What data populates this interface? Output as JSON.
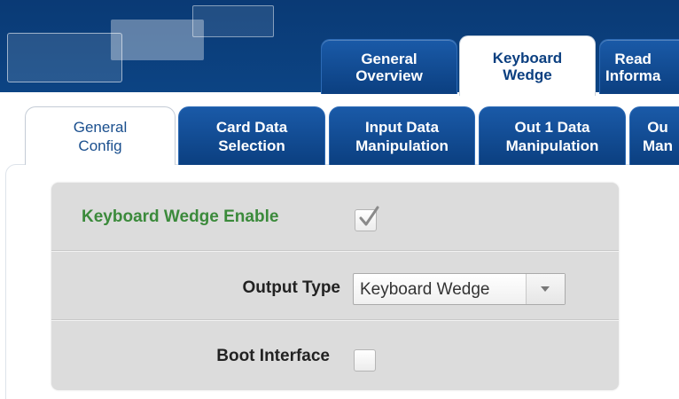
{
  "top_tabs": [
    {
      "label": "General\nOverview",
      "active": false
    },
    {
      "label": "Keyboard\nWedge",
      "active": true
    },
    {
      "label": "Read\nInforma",
      "active": false
    }
  ],
  "sub_tabs": [
    {
      "label": "General\nConfig",
      "active": true
    },
    {
      "label": "Card Data\nSelection",
      "active": false
    },
    {
      "label": "Input Data\nManipulation",
      "active": false
    },
    {
      "label": "Out 1 Data\nManipulation",
      "active": false
    },
    {
      "label": "Ou\nMan",
      "active": false
    }
  ],
  "config": {
    "keyboard_wedge_enable": {
      "label": "Keyboard Wedge Enable",
      "checked": true
    },
    "output_type": {
      "label": "Output Type",
      "value": "Keyboard Wedge"
    },
    "boot_interface": {
      "label": "Boot Interface",
      "checked": false
    }
  },
  "colors": {
    "header_blue": "#0b3d7a",
    "tab_blue": "#1a5aa8",
    "enabled_green": "#3b8a3b",
    "panel_gray": "#dcdcdc"
  }
}
